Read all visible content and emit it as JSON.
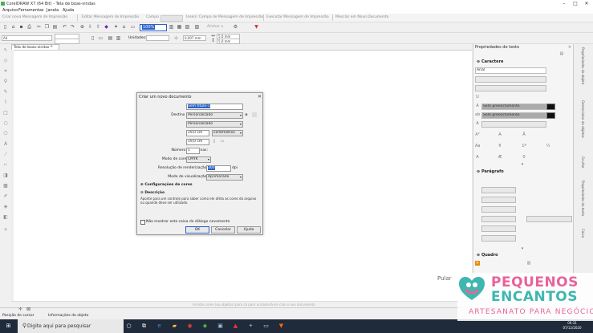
{
  "window": {
    "title": "CorelDRAW X7 (64 Bit) - Tela de boas-vindas",
    "minimize": "–",
    "maximize": "□",
    "close": "✕"
  },
  "menu": [
    "Arquivo",
    "Ferramentas",
    "Janela",
    "Ajuda"
  ],
  "macrobar": {
    "create_macro": "Criar nova Mensagem de Impressão",
    "edit_macro": "Editar Mensagem de Impressão",
    "field_label": "Campo",
    "insert_field": "Inserir Campo de Mensagem de Impressão",
    "run_macro": "Executar Mensagem de Impressão",
    "merge_new": "Mesclar em Novo Documento"
  },
  "standard": {
    "zoom": "100%",
    "snap": "Alinhar a"
  },
  "propbar": {
    "font": "A4",
    "units_label": "Unidades:",
    "nudge": "0,007 mm",
    "dup_x": "5,0 mm",
    "dup_y": "5,0 mm"
  },
  "doc_tab": {
    "label": "Tela de boas-vindas",
    "add": "+"
  },
  "hint": "Arraste cores (ou objetos) para cá para armazená-los com o seu documento",
  "skip": "Pular",
  "dialog": {
    "title": "Criar um novo documento",
    "close": "✕",
    "name_label": "Nome:",
    "name_value": "Sem título-1",
    "preset_label": "Destino predefinido:",
    "preset_value": "Personalizado",
    "size_label": "Tamanho:",
    "size_value": "Personalizado",
    "width_label": "Largura:",
    "width_value": "19,0 cm",
    "width_units": "centímetros",
    "height_label": "Altura:",
    "height_value": "19,0 cm",
    "pages_label": "Número de páginas:",
    "pages_value": "1",
    "color_mode_label": "Modo de cores primárias:",
    "color_mode_value": "CMYK",
    "resolution_label": "Resolução de renderização:",
    "resolution_value": "300",
    "resolution_unit": "dpi",
    "preview_label": "Modo de visualização:",
    "preview_value": "Aprimorado",
    "color_settings": "Configurações de cores",
    "description_heading": "Descrição",
    "description_text": "Aponte para um controle para saber como ele afeta as cores do arquivo ou quando deve ser utilizado.",
    "dont_show": "Não mostrar esta caixa de diálogo novamente",
    "ok": "OK",
    "cancel": "Cancelar",
    "help": "Ajuda"
  },
  "panel": {
    "title": "Propriedades do texto",
    "character": "Caractere",
    "font": "Arial",
    "fill_none": "Sem preenchimento",
    "bg_none": "Sem preenchimento",
    "paragraph": "Parágrafo",
    "frame": "Quadro"
  },
  "side_tabs": [
    "Propriedades do objeto",
    "Gerenciador de objetos",
    "Ocultar",
    "Propriedades do texto",
    "Caixa"
  ],
  "status": {
    "cursor": "Posição do cursor",
    "object_info": "Informações do objeto"
  },
  "taskbar": {
    "search": "Digite aqui para pesquisar",
    "time": "09:31",
    "date": "07/12/2020"
  },
  "brand": {
    "line1": "PEQUENOS",
    "line2": "ENCANTOS",
    "line3": "ARTESANATO PARA NEGÓCIOS"
  },
  "colors": {
    "accent": "#2a62c9",
    "brand_pink": "#e8639a",
    "brand_teal": "#3fb7b0",
    "taskbar": "#1f2a3a"
  }
}
